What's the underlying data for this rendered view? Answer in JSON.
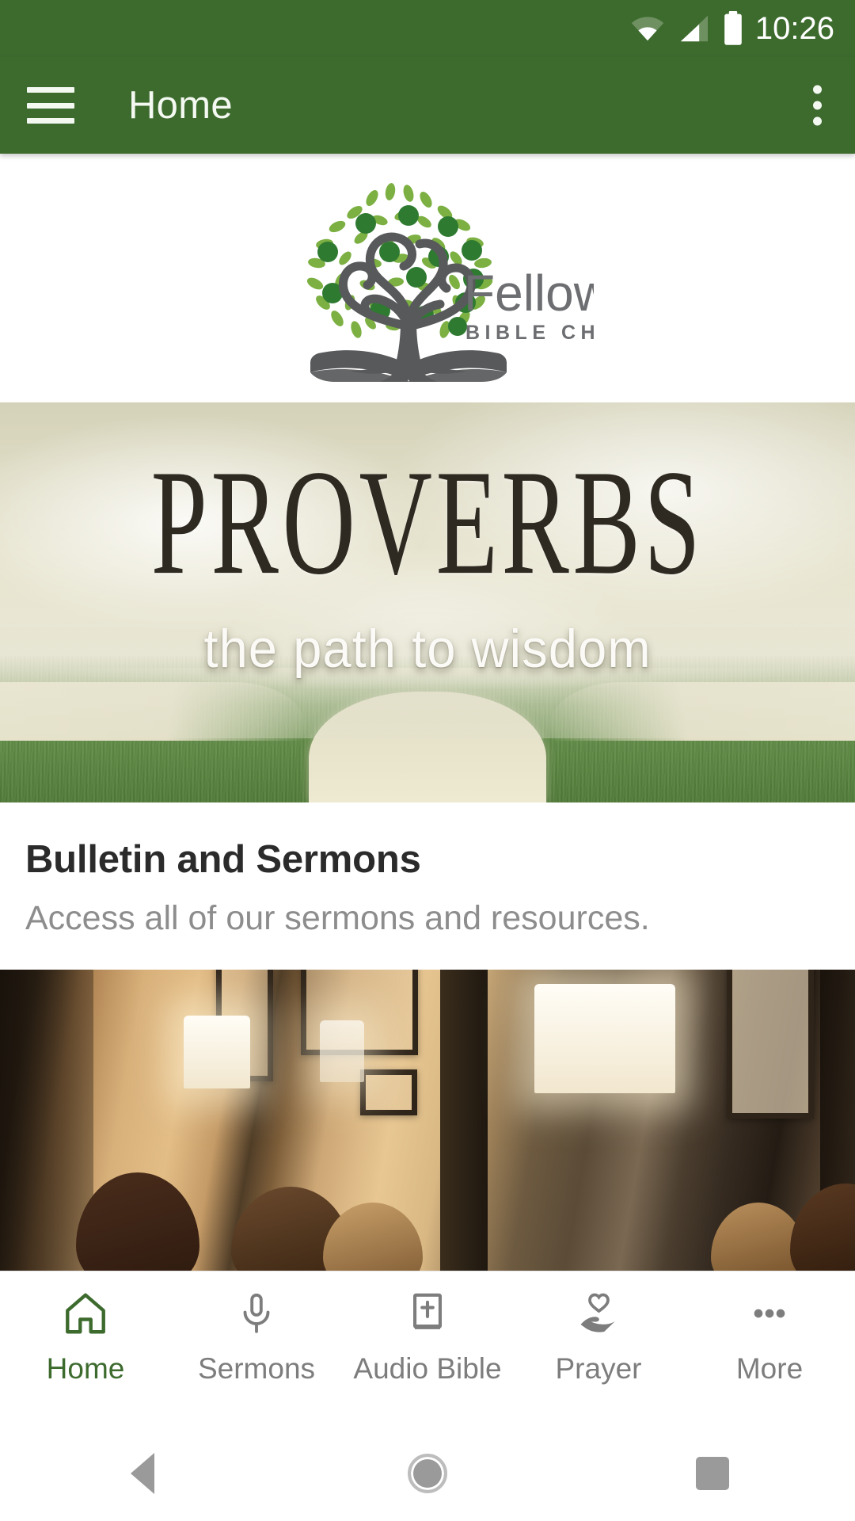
{
  "status_bar": {
    "time": "10:26",
    "icons": [
      "wifi-icon",
      "cellular-signal-icon",
      "battery-icon"
    ]
  },
  "app_bar": {
    "menu_icon": "hamburger-menu-icon",
    "title": "Home",
    "overflow_icon": "more-vertical-icon",
    "background_color": "#3D6B2E"
  },
  "logo_card": {
    "name_line1": "Fellowship",
    "name_line2": "BIBLE CHURCH",
    "graphic": "tree-with-open-book-logo"
  },
  "banner": {
    "title": "PROVERBS",
    "subtitle": "the path to wisdom",
    "image_description": "forking-dirt-path-through-green-field-under-cloudy-sky"
  },
  "feature": {
    "title": "Bulletin and Sermons",
    "description": "Access all of our sermons and resources."
  },
  "photo_card": {
    "image_description": "people-seated-in-warmly-lit-living-room"
  },
  "tab_bar": {
    "active_color": "#3D6B2E",
    "inactive_color": "#7D7D7D",
    "tabs": [
      {
        "label": "Home",
        "icon": "home-icon",
        "active": true
      },
      {
        "label": "Sermons",
        "icon": "microphone-icon",
        "active": false
      },
      {
        "label": "Audio Bible",
        "icon": "bible-book-icon",
        "active": false
      },
      {
        "label": "Prayer",
        "icon": "hand-holding-heart-icon",
        "active": false
      },
      {
        "label": "More",
        "icon": "ellipsis-icon",
        "active": false
      }
    ]
  },
  "system_nav": {
    "back": "back-triangle-icon",
    "home": "home-circle-icon",
    "recents": "recents-square-icon"
  }
}
